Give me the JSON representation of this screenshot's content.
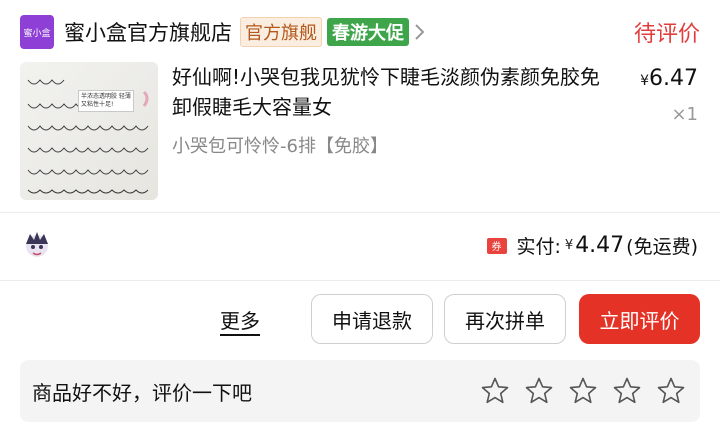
{
  "store": {
    "logo_text": "蜜小盒",
    "name": "蜜小盒官方旗舰店",
    "badge_official": "官方旗舰",
    "badge_promo": "春游大促",
    "order_status": "待评价"
  },
  "product": {
    "thumb_label": "半浓态透明胶 轻薄又粘性十足!",
    "title": "好仙啊!小哭包我见犹怜下睫毛淡颜伪素颜免胶免卸假睫毛大容量女",
    "variant": "小哭包可怜怜-6排【免胶】",
    "price_currency": "¥",
    "price": "6.47",
    "quantity": "×1"
  },
  "payment": {
    "coupon_icon": "券",
    "label": "实付:",
    "currency": "¥",
    "amount": "4.47",
    "note": "(免运费)"
  },
  "actions": {
    "more": "更多",
    "refund": "申请退款",
    "regroup": "再次拼单",
    "review": "立即评价"
  },
  "review": {
    "prompt": "商品好不好，评价一下吧",
    "rating": 0,
    "max_rating": 5
  },
  "colors": {
    "status_red": "#e23d3d",
    "primary_button": "#e53227",
    "promo_green": "#3fa54a",
    "logo_purple": "#8e3fd6"
  }
}
